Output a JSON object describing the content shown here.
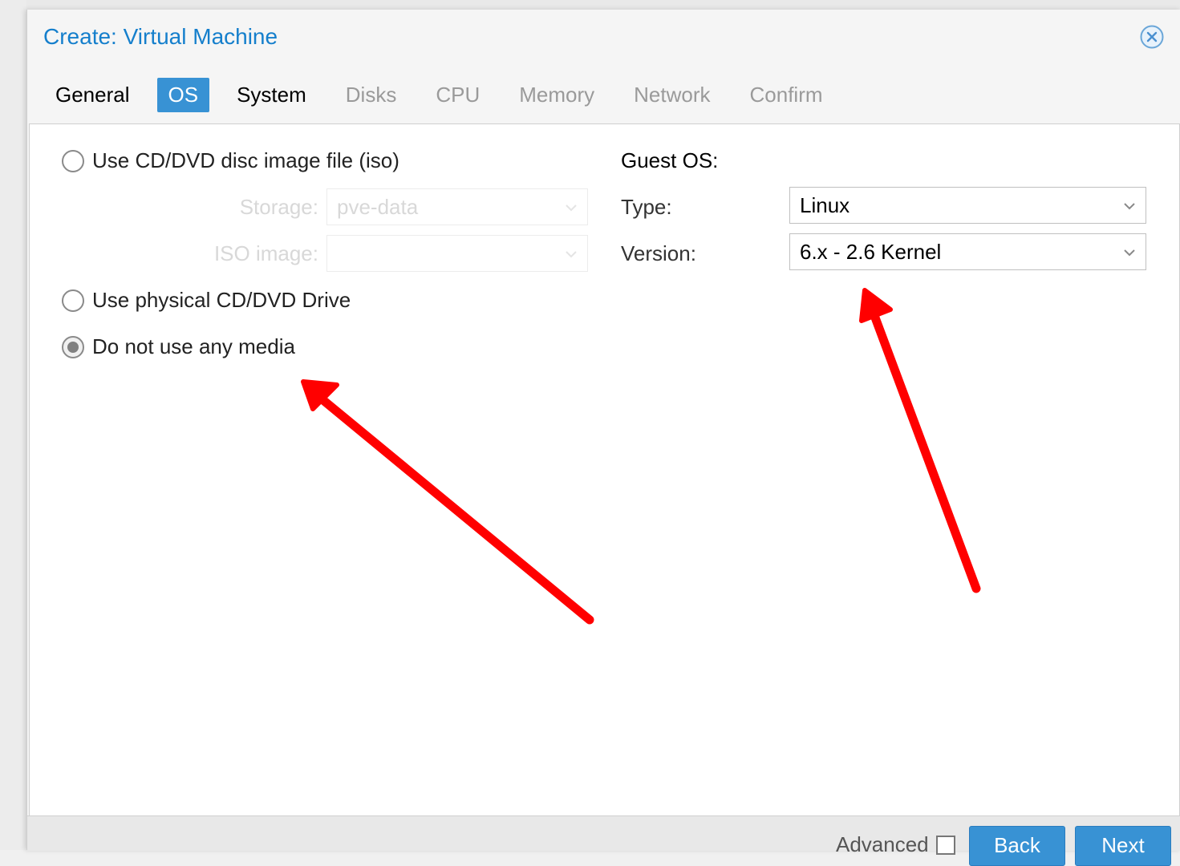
{
  "dialog": {
    "title": "Create: Virtual Machine",
    "close_icon": "close-circle-icon"
  },
  "tabs": [
    {
      "label": "General",
      "state": "normal"
    },
    {
      "label": "OS",
      "state": "active"
    },
    {
      "label": "System",
      "state": "normal"
    },
    {
      "label": "Disks",
      "state": "disabled"
    },
    {
      "label": "CPU",
      "state": "disabled"
    },
    {
      "label": "Memory",
      "state": "disabled"
    },
    {
      "label": "Network",
      "state": "disabled"
    },
    {
      "label": "Confirm",
      "state": "disabled"
    }
  ],
  "media": {
    "option_iso": "Use CD/DVD disc image file (iso)",
    "storage_label": "Storage:",
    "storage_value": "pve-data",
    "iso_label": "ISO image:",
    "iso_value": "",
    "option_physical": "Use physical CD/DVD Drive",
    "option_none": "Do not use any media",
    "selected": "none"
  },
  "guest_os": {
    "heading": "Guest OS:",
    "type_label": "Type:",
    "type_value": "Linux",
    "version_label": "Version:",
    "version_value": "6.x - 2.6 Kernel"
  },
  "footer": {
    "advanced_label": "Advanced",
    "advanced_checked": false,
    "back_label": "Back",
    "next_label": "Next"
  },
  "colors": {
    "accent": "#3892d4",
    "title": "#157fcc",
    "annotation_arrow": "#ff0000"
  }
}
